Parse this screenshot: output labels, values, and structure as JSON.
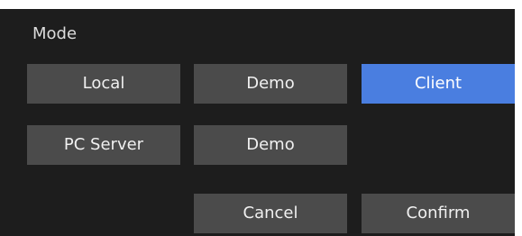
{
  "dialog": {
    "title": "Mode",
    "colors": {
      "background": "#1d1d1d",
      "button": "#4b4b4b",
      "selected": "#4a7ee0",
      "text": "#f0f0f0"
    },
    "modes": [
      {
        "label": "Local"
      },
      {
        "label": "Demo"
      },
      {
        "label": "Client",
        "selected": true
      },
      {
        "label": "PC Server"
      },
      {
        "label": "Demo"
      }
    ],
    "actions": {
      "cancel_label": "Cancel",
      "confirm_label": "Confirm"
    }
  }
}
